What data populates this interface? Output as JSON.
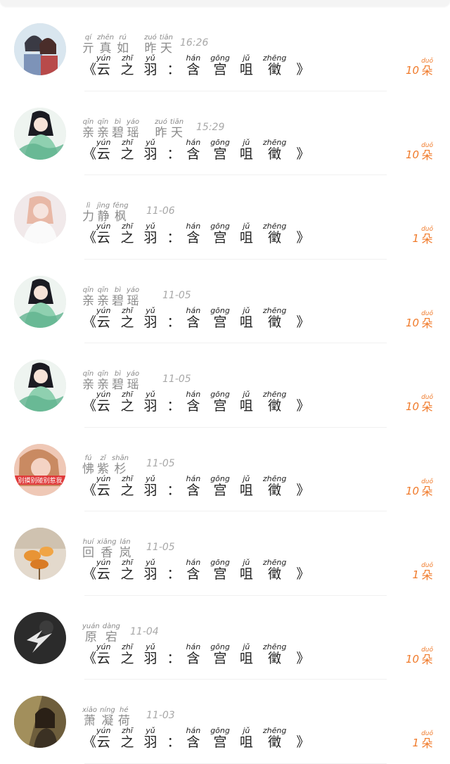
{
  "accent_color": "#f07a2a",
  "title": {
    "open_quote": "《",
    "chars": [
      {
        "py": "yún",
        "hz": "云"
      },
      {
        "py": "zhī",
        "hz": "之"
      },
      {
        "py": "yǔ",
        "hz": "羽"
      }
    ],
    "colon": "：",
    "chars2": [
      {
        "py": "hán",
        "hz": "含"
      },
      {
        "py": "gōng",
        "hz": "宫"
      },
      {
        "py": "jǔ",
        "hz": "咀"
      },
      {
        "py": "zhēng",
        "hz": "徵"
      }
    ],
    "close_quote": "》"
  },
  "unit": {
    "py": "duǒ",
    "hz": "朵"
  },
  "comments": [
    {
      "avatar": "anime-couple-avatar",
      "name": [
        {
          "py": "qí",
          "hz": "亓"
        },
        {
          "py": "zhēn",
          "hz": "真"
        },
        {
          "py": "rú",
          "hz": "如"
        }
      ],
      "day": [
        {
          "py": "zuó",
          "hz": "昨"
        },
        {
          "py": "tiān",
          "hz": "天"
        }
      ],
      "time": "16:26",
      "count": "10"
    },
    {
      "avatar": "anime-girl-green-avatar",
      "name": [
        {
          "py": "qīn",
          "hz": "亲"
        },
        {
          "py": "qīn",
          "hz": "亲"
        },
        {
          "py": "bì",
          "hz": "碧"
        },
        {
          "py": "yáo",
          "hz": "瑶"
        }
      ],
      "day": [
        {
          "py": "zuó",
          "hz": "昨"
        },
        {
          "py": "tiān",
          "hz": "天"
        }
      ],
      "time": "15:29",
      "count": "10"
    },
    {
      "avatar": "girl-white-avatar",
      "name": [
        {
          "py": "lì",
          "hz": "力"
        },
        {
          "py": "jìng",
          "hz": "静"
        },
        {
          "py": "fēng",
          "hz": "枫"
        }
      ],
      "day": [],
      "time": "11-06",
      "count": "1"
    },
    {
      "avatar": "anime-girl-green-avatar",
      "name": [
        {
          "py": "qīn",
          "hz": "亲"
        },
        {
          "py": "qīn",
          "hz": "亲"
        },
        {
          "py": "bì",
          "hz": "碧"
        },
        {
          "py": "yáo",
          "hz": "瑶"
        }
      ],
      "day": [],
      "time": "11-05",
      "count": "10"
    },
    {
      "avatar": "anime-girl-green-avatar",
      "name": [
        {
          "py": "qīn",
          "hz": "亲"
        },
        {
          "py": "qīn",
          "hz": "亲"
        },
        {
          "py": "bì",
          "hz": "碧"
        },
        {
          "py": "yáo",
          "hz": "瑶"
        }
      ],
      "day": [],
      "time": "11-05",
      "count": "10"
    },
    {
      "avatar": "woman-red-banner-avatar",
      "name": [
        {
          "py": "fú",
          "hz": "怫"
        },
        {
          "py": "zǐ",
          "hz": "紫"
        },
        {
          "py": "shān",
          "hz": "杉"
        }
      ],
      "day": [],
      "time": "11-05",
      "count": "10",
      "avatar_text": "别摸别碰别惹我"
    },
    {
      "avatar": "orange-flowers-avatar",
      "name": [
        {
          "py": "huí",
          "hz": "回"
        },
        {
          "py": "xiāng",
          "hz": "香"
        },
        {
          "py": "lán",
          "hz": "岚"
        }
      ],
      "day": [],
      "time": "11-05",
      "count": "1"
    },
    {
      "avatar": "lightning-dark-avatar",
      "name": [
        {
          "py": "yuán",
          "hz": "原"
        },
        {
          "py": "dàng",
          "hz": "宕"
        }
      ],
      "day": [],
      "time": "11-04",
      "count": "10"
    },
    {
      "avatar": "vintage-woman-avatar",
      "name": [
        {
          "py": "xiāo",
          "hz": "萧"
        },
        {
          "py": "níng",
          "hz": "凝"
        },
        {
          "py": "hé",
          "hz": "荷"
        }
      ],
      "day": [],
      "time": "11-03",
      "count": "1"
    }
  ]
}
